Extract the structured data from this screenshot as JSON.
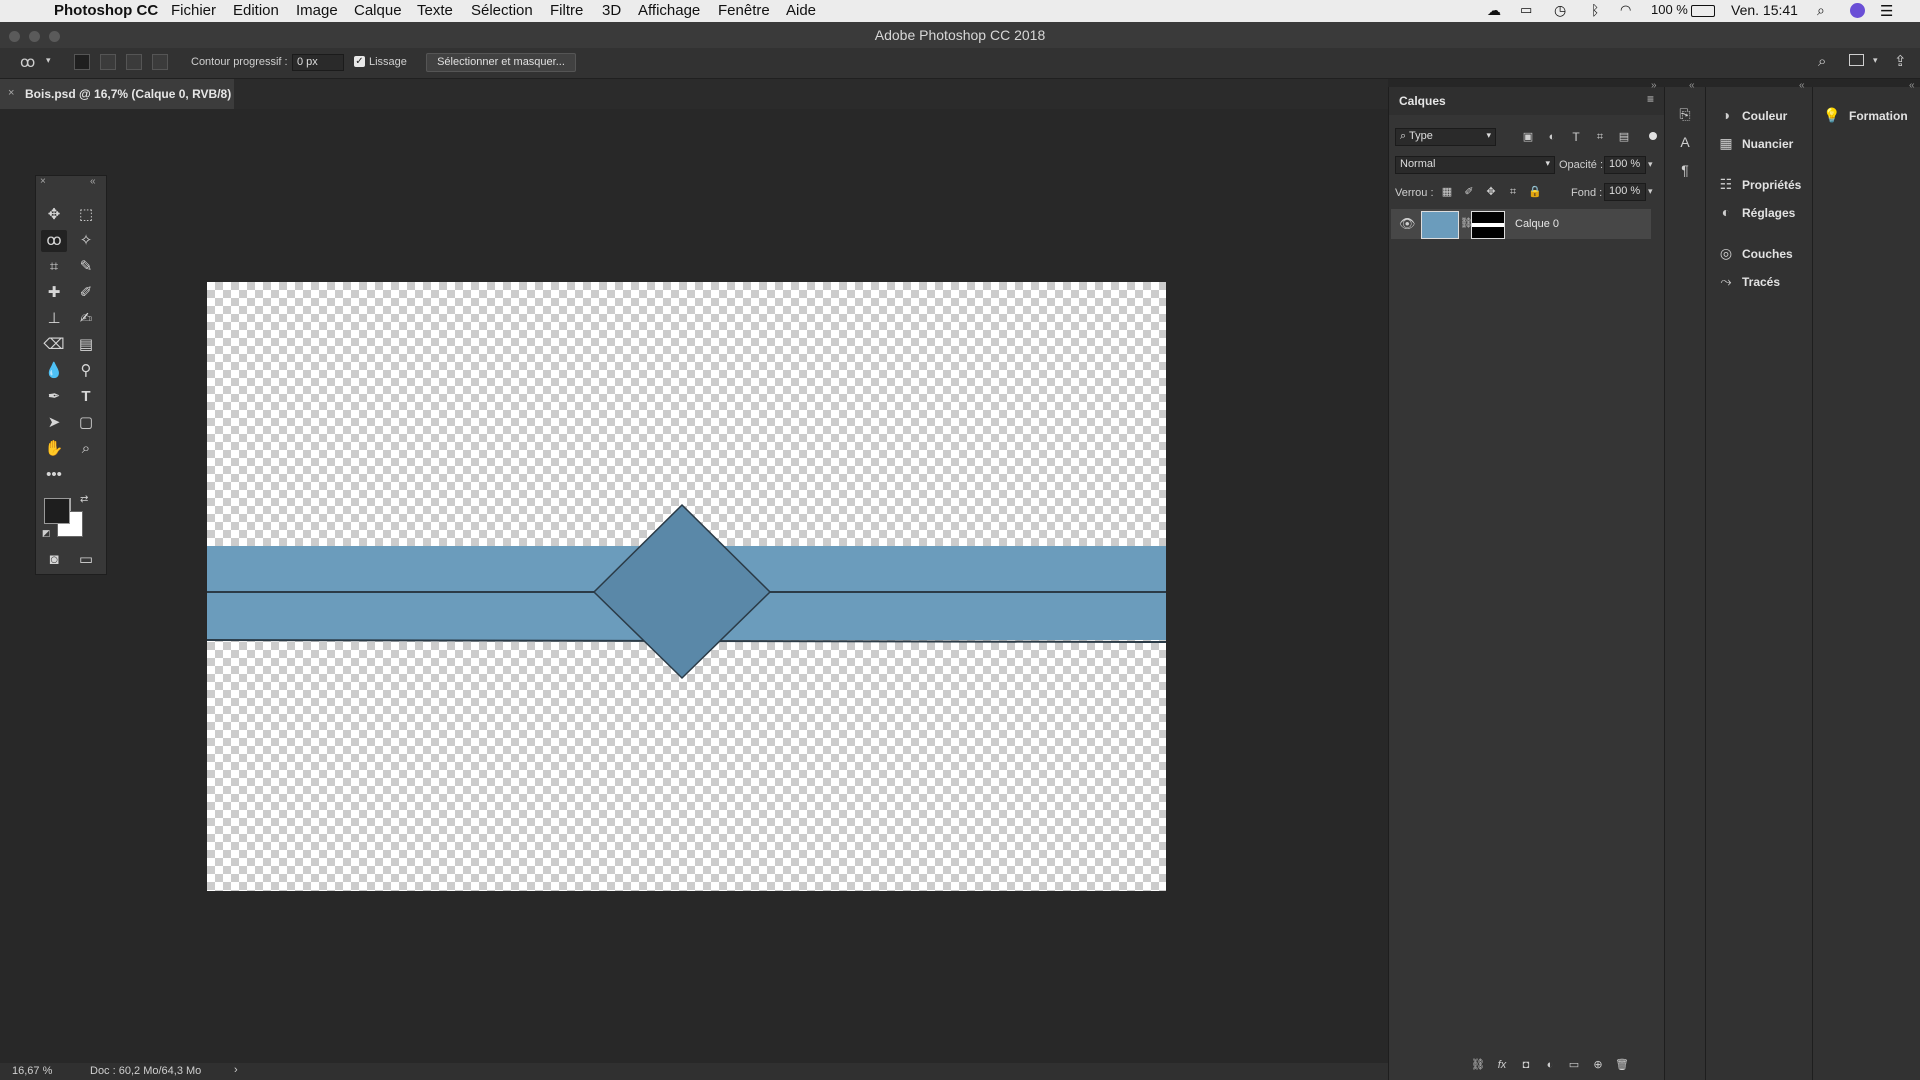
{
  "menubar": {
    "app_name": "Photoshop CC",
    "items": [
      "Fichier",
      "Edition",
      "Image",
      "Calque",
      "Texte",
      "Sélection",
      "Filtre",
      "3D",
      "Affichage",
      "Fenêtre",
      "Aide"
    ],
    "battery": "100 %",
    "clock": "Ven. 15:41"
  },
  "window": {
    "title": "Adobe Photoshop CC 2018"
  },
  "options": {
    "feather_label": "Contour progressif :",
    "feather_value": "0 px",
    "smoothing_label": "Lissage",
    "select_mask_button": "Sélectionner et masquer..."
  },
  "document": {
    "tab_title": "Bois.psd @ 16,7% (Calque 0, RVB/8)",
    "image_colors": {
      "wood": "#6b9cbc",
      "wood_dark": "#5a88a8",
      "seam": "#2b3b47"
    }
  },
  "status": {
    "zoom": "16,67 %",
    "doc_info": "Doc : 60,2 Mo/64,3 Mo"
  },
  "layers_panel": {
    "title": "Calques",
    "filter_value": "Type",
    "blend_mode": "Normal",
    "opacity_label": "Opacité :",
    "opacity_value": "100 %",
    "lock_label": "Verrou :",
    "fill_label": "Fond :",
    "fill_value": "100 %",
    "layers": [
      {
        "name": "Calque 0",
        "visible": true
      }
    ]
  },
  "right_panels": {
    "items": [
      "Couleur",
      "Nuancier",
      "Propriétés",
      "Réglages",
      "Couches",
      "Tracés"
    ],
    "learn": "Formation"
  },
  "colors": {
    "foreground": "#1e1e1e",
    "background": "#ffffff",
    "accent_select": "#4a4a4a"
  }
}
